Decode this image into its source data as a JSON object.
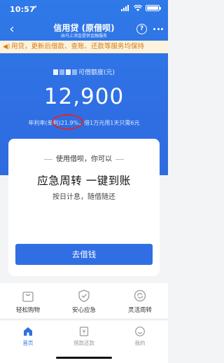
{
  "status": {
    "time": "10:57"
  },
  "nav": {
    "title": "信用贷 (原借呗)",
    "subtitle": "由马上消金提供金融服务",
    "help": "?"
  },
  "notice": {
    "text": "用贷，更新后借款、查账、还款等服务均保持"
  },
  "credit": {
    "label_suffix": "可借额度(元)",
    "amount": "12,900",
    "rate_line": "年利率(单利)21.9%，借1万元用1天只需6元"
  },
  "card": {
    "subtitle": "使用借呗，你可以",
    "title": "应急周转 一键到账",
    "desc": "按日计息，随借随还",
    "button": "去借钱"
  },
  "features": [
    {
      "label": "轻松购物",
      "icon": "shopping-bag-icon"
    },
    {
      "label": "安心应急",
      "icon": "shield-icon"
    },
    {
      "label": "灵活周转",
      "icon": "refresh-icon"
    }
  ],
  "tabs": [
    {
      "label": "首页",
      "icon": "home-icon"
    },
    {
      "label": "借款还款",
      "icon": "bill-icon"
    },
    {
      "label": "我的",
      "icon": "user-icon"
    }
  ],
  "colors": {
    "brand": "#2f6fe3",
    "notice_bg": "#fdf3dc",
    "notice_text": "#d77a12",
    "annotation": "#e1262b"
  }
}
